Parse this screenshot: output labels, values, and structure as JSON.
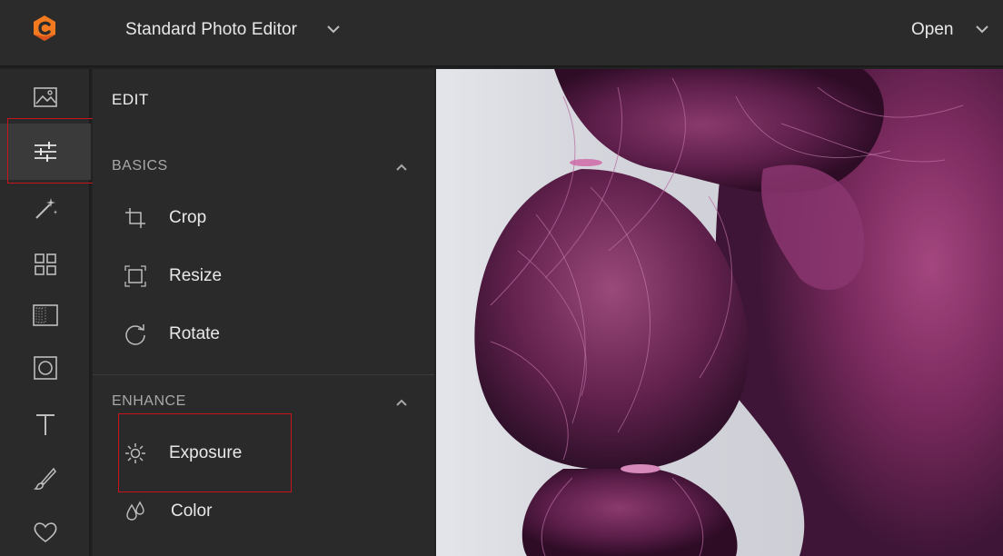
{
  "app": {
    "title": "Standard Photo Editor",
    "open_label": "Open",
    "brand_color": "#f47a20"
  },
  "toolbar": {
    "items": [
      {
        "name": "image",
        "icon": "image-icon",
        "active": false
      },
      {
        "name": "adjust",
        "icon": "sliders-icon",
        "active": true
      },
      {
        "name": "effects",
        "icon": "magic-wand-icon",
        "active": false
      },
      {
        "name": "frames",
        "icon": "grid-icon",
        "active": false
      },
      {
        "name": "textures",
        "icon": "texture-icon",
        "active": false
      },
      {
        "name": "overlay",
        "icon": "overlay-icon",
        "active": false
      },
      {
        "name": "text",
        "icon": "text-icon",
        "active": false
      },
      {
        "name": "draw",
        "icon": "brush-icon",
        "active": false
      },
      {
        "name": "favorites",
        "icon": "heart-icon",
        "active": false
      }
    ]
  },
  "panel": {
    "title": "EDIT",
    "basics": {
      "heading": "BASICS",
      "items": [
        {
          "label": "Crop",
          "icon": "crop-icon"
        },
        {
          "label": "Resize",
          "icon": "resize-icon"
        },
        {
          "label": "Rotate",
          "icon": "rotate-icon"
        }
      ]
    },
    "enhance": {
      "heading": "ENHANCE",
      "items": [
        {
          "label": "Exposure",
          "icon": "sun-icon"
        },
        {
          "label": "Color",
          "icon": "droplets-icon"
        }
      ]
    }
  },
  "highlight_color": "#c8141c"
}
